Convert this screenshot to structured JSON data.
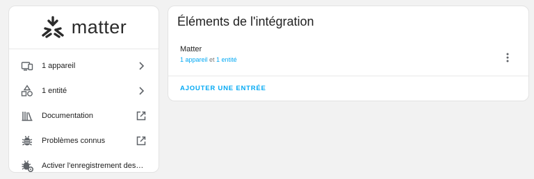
{
  "brand": {
    "wordmark": "matter",
    "accent_color": "#03a9f4"
  },
  "sidebar": {
    "items": [
      {
        "label": "1 appareil",
        "icon": "devices-icon",
        "trailing": "chevron-right-icon"
      },
      {
        "label": "1 entité",
        "icon": "shapes-icon",
        "trailing": "chevron-right-icon"
      },
      {
        "label": "Documentation",
        "icon": "bookshelf-icon",
        "trailing": "open-in-new-icon"
      },
      {
        "label": "Problèmes connus",
        "icon": "bug-icon",
        "trailing": "open-in-new-icon"
      },
      {
        "label": "Activer l'enregistrement des journaux de débogage",
        "icon": "bug-settings-icon",
        "trailing": ""
      }
    ]
  },
  "main": {
    "title": "Éléments de l'intégration",
    "entries": [
      {
        "name": "Matter",
        "devices_link": "1 appareil",
        "separator": " et ",
        "entities_link": "1 entité"
      }
    ],
    "add_entry_label": "AJOUTER UNE ENTRÉE"
  }
}
